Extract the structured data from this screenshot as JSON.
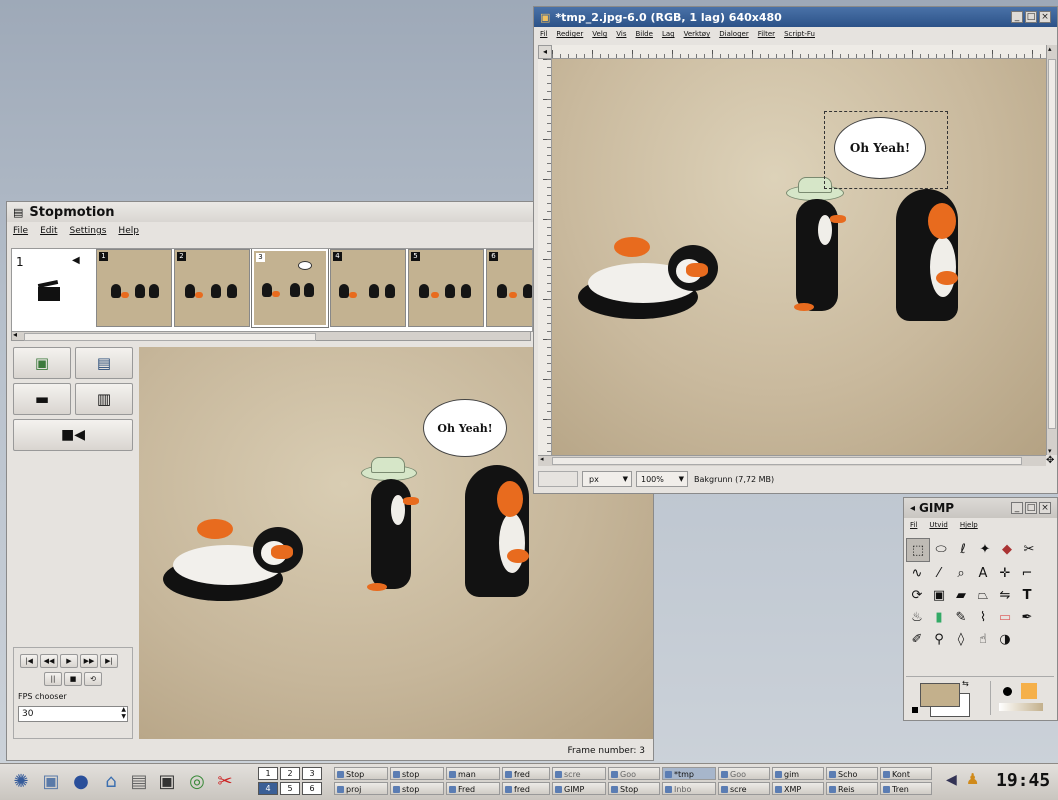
{
  "stopmotion": {
    "title": "Stopmotion",
    "menu": [
      "File",
      "Edit",
      "Settings",
      "Help"
    ],
    "scene_slot_number": "1",
    "frames": [
      {
        "label": "1"
      },
      {
        "label": "2"
      },
      {
        "label": "3"
      },
      {
        "label": "4"
      },
      {
        "label": "5"
      },
      {
        "label": "6"
      }
    ],
    "bubble_text": "Oh Yeah!",
    "fps_label": "FPS chooser",
    "fps_value": "30",
    "frame_number_text": "Frame number: 3"
  },
  "gimp_image": {
    "title": "*tmp_2.jpg-6.0 (RGB, 1 lag) 640x480",
    "menu": [
      "Fil",
      "Rediger",
      "Velg",
      "Vis",
      "Bilde",
      "Lag",
      "Verktøy",
      "Dialoger",
      "Filter",
      "Script-Fu"
    ],
    "bubble_text": "Oh Yeah!",
    "unit_value": "px",
    "zoom_value": "100%",
    "status_text": "Bakgrunn (7,72 MB)"
  },
  "gimp_toolbox": {
    "title": "GIMP",
    "menu": [
      "Fil",
      "Utvid",
      "Hjelp"
    ],
    "tool_icons": [
      "rect-select-icon",
      "ellipse-select-icon",
      "lasso-icon",
      "fuzzy-select-icon",
      "color-select-icon",
      "scissors-icon",
      "paths-icon",
      "color-picker-icon",
      "zoom-icon",
      "measure-icon",
      "move-icon",
      "crop-icon",
      "rotate-icon",
      "scale-icon",
      "shear-icon",
      "perspective-icon",
      "flip-icon",
      "text-icon",
      "bucket-fill-icon",
      "blend-icon",
      "pencil-icon",
      "paintbrush-icon",
      "eraser-icon",
      "airbrush-icon",
      "ink-icon",
      "clone-icon",
      "heal-icon",
      "smudge-icon",
      "dodge-burn-icon"
    ],
    "fg_color": "#c3b08c",
    "bg_color": "#ffffff"
  },
  "taskbar": {
    "desktops": [
      "1",
      "2",
      "3",
      "4",
      "5",
      "6"
    ],
    "tasks_top": [
      "Stop",
      "stop",
      "man",
      "fred",
      "scre",
      "Goo",
      "*tmp",
      "Goo",
      "gim",
      "Scho",
      "Kont"
    ],
    "tasks_bottom": [
      "proj",
      "stop",
      "Fred",
      "fred",
      "GIMP",
      "Stop",
      "Inbo",
      "scre",
      "XMP",
      "Reis",
      "Tren"
    ],
    "clock": "19:45"
  }
}
